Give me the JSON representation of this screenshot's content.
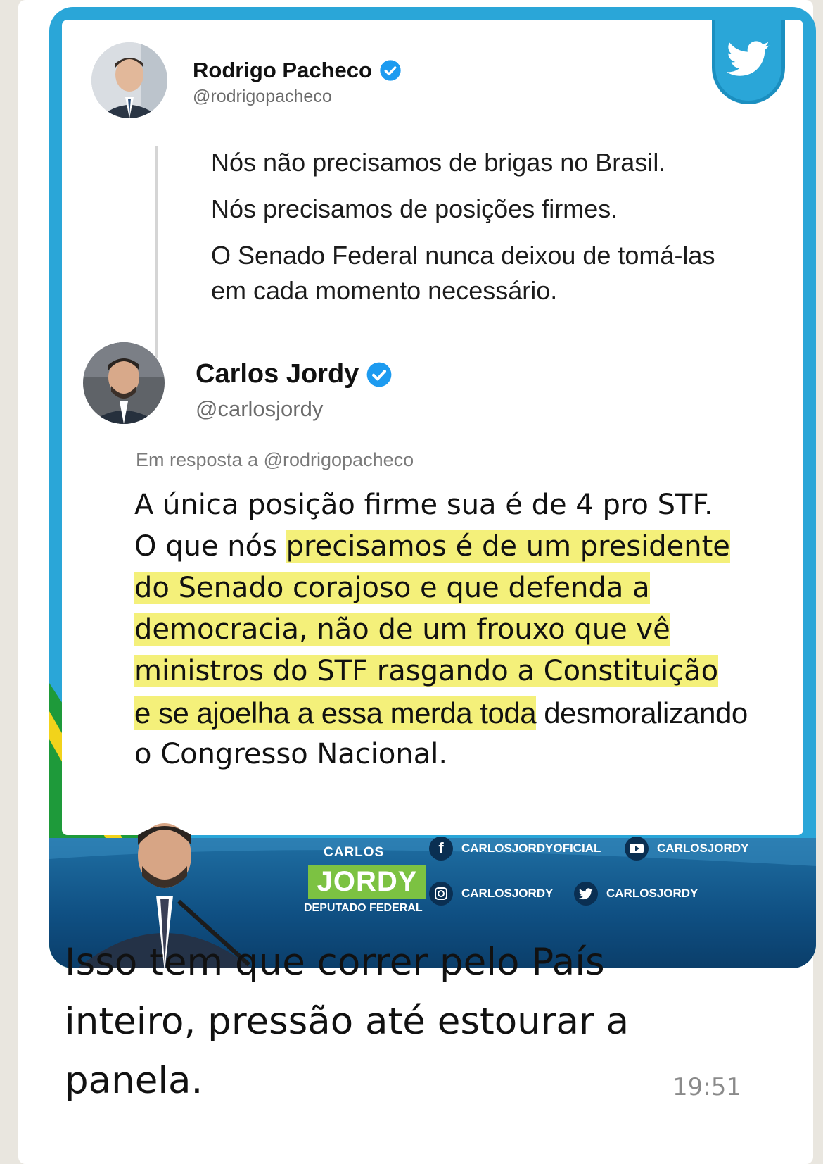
{
  "tweet1": {
    "name": "Rodrigo Pacheco",
    "handle": "@rodrigopacheco",
    "lines": [
      "Nós não precisamos de brigas no Brasil.",
      "Nós precisamos de posições firmes.",
      "O Senado Federal nunca deixou de tomá-las",
      "em cada momento necessário."
    ]
  },
  "tweet2": {
    "name": "Carlos Jordy",
    "handle": "@carlosjordy",
    "reply_to": "Em resposta a @rodrigopacheco",
    "line1": "A única posição firme sua é de 4 pro STF.",
    "line2_plain": "O que nós ",
    "line2_hl": "precisamos é de um presidente",
    "line3_hl": "do Senado corajoso e que defenda a",
    "line4_hl": "democracia, não de um frouxo que vê",
    "line5_hl": "ministros do STF rasgando a Constituição",
    "line6_hl": "e se ajoelha a essa merda toda",
    "line6_plain": " desmoralizando",
    "line7": "o Congresso Nacional."
  },
  "banner": {
    "brand_first": "CARLOS",
    "brand_last": "JORDY",
    "brand_role": "DEPUTADO FEDERAL",
    "social": [
      {
        "icon": "facebook-icon",
        "label": "CARLOSJORDYOFICIAL"
      },
      {
        "icon": "youtube-icon",
        "label": "CARLOSJORDY"
      },
      {
        "icon": "instagram-icon",
        "label": "CARLOSJORDY"
      },
      {
        "icon": "twitter-icon",
        "label": "CARLOSJORDY"
      }
    ],
    "colors": {
      "banner": "#0f4f82",
      "brand_green": "#7cc242",
      "flag_green": "#1e9a3a",
      "flag_yellow": "#f2d31b"
    }
  },
  "message": {
    "caption_lines": [
      "Isso tem que correr pelo País",
      "inteiro, pressão até estourar a",
      "panela."
    ],
    "time": "19:51"
  },
  "colors": {
    "frame": "#2aa6d8",
    "verified": "#1d9bf0",
    "highlight": "#f4f07a"
  }
}
